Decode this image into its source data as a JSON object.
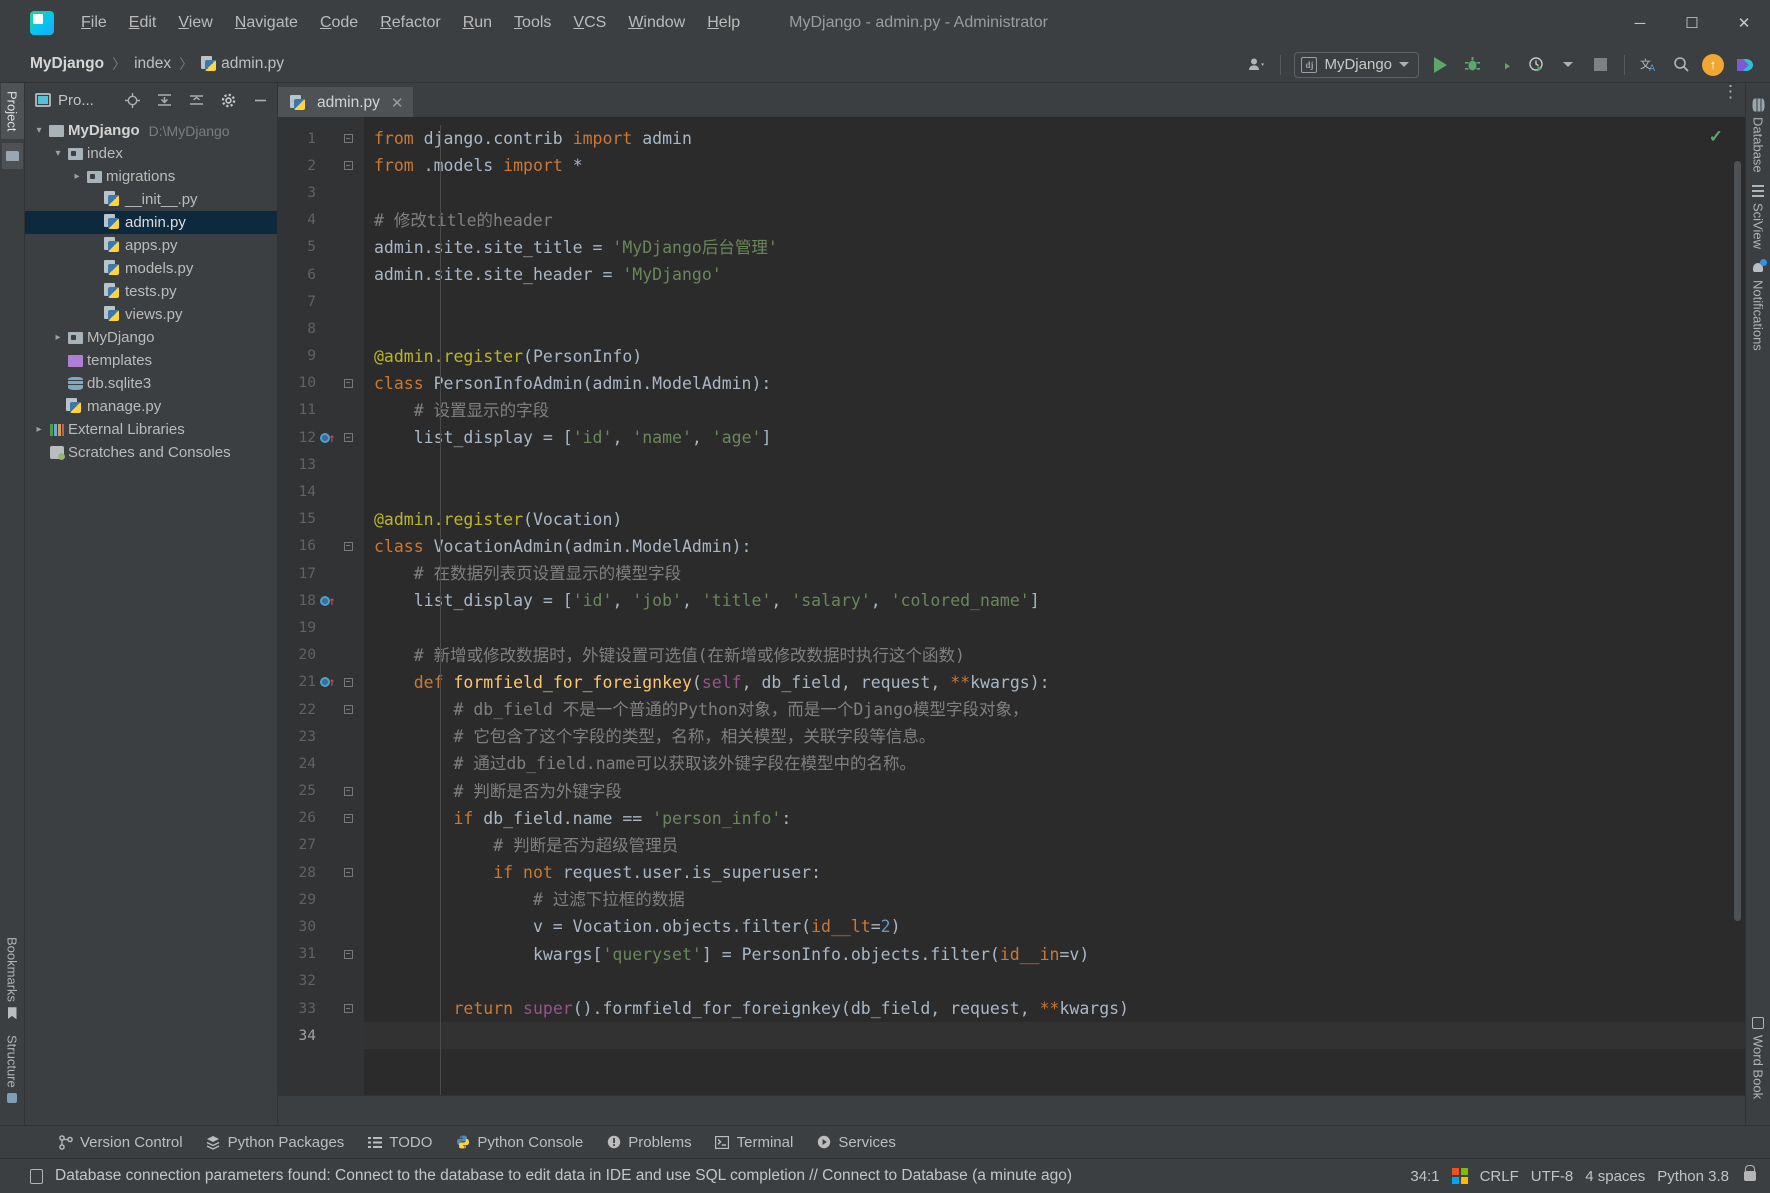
{
  "window": {
    "title": "MyDjango - admin.py - Administrator",
    "minimize": "─",
    "maximize": "☐",
    "close": "✕"
  },
  "menu": [
    {
      "label": "File"
    },
    {
      "label": "Edit"
    },
    {
      "label": "View"
    },
    {
      "label": "Navigate"
    },
    {
      "label": "Code"
    },
    {
      "label": "Refactor"
    },
    {
      "label": "Run"
    },
    {
      "label": "Tools"
    },
    {
      "label": "VCS"
    },
    {
      "label": "Window"
    },
    {
      "label": "Help"
    }
  ],
  "breadcrumb": {
    "project": "MyDjango",
    "folder": "index",
    "file": "admin.py",
    "sep": "〉"
  },
  "toolbar": {
    "run_config": "MyDjango",
    "django_badge": "dj",
    "run_label": "Run",
    "debug_label": "Debug",
    "coverage_label": "Run with Coverage",
    "profile_label": "Profile",
    "stop_label": "Stop",
    "translate_label": "文A",
    "search_label": "Search Everywhere",
    "update_label": "Update",
    "plugin_label": "Plugin"
  },
  "left_rail": [
    {
      "label": "Project",
      "icon": "project-folder-icon",
      "active": true
    },
    {
      "label": "Bookmarks",
      "icon": "bookmark-icon",
      "active": false
    },
    {
      "label": "Structure",
      "icon": "structure-icon",
      "active": false
    }
  ],
  "right_rail": [
    {
      "label": "Database",
      "icon": "database-icon"
    },
    {
      "label": "SciView",
      "icon": "grid-icon"
    },
    {
      "label": "Notifications",
      "icon": "bell-icon"
    },
    {
      "label": "Word Book",
      "icon": "wordbook-icon"
    }
  ],
  "project_panel": {
    "title": "Pro...",
    "buttons": [
      "locate-icon",
      "expand-all-icon",
      "collapse-all-icon",
      "settings-gear-icon",
      "hide-icon"
    ],
    "tree": [
      {
        "label": "MyDjango",
        "path": "D:\\MyDjango",
        "icon": "folder-icon",
        "indent": 0,
        "arrow": "down",
        "bold": true,
        "selected": false
      },
      {
        "label": "index",
        "path": "",
        "icon": "source-folder-icon",
        "indent": 1,
        "arrow": "down",
        "bold": false,
        "selected": false
      },
      {
        "label": "migrations",
        "path": "",
        "icon": "source-folder-icon",
        "indent": 2,
        "arrow": "right",
        "bold": false,
        "selected": false
      },
      {
        "label": "__init__.py",
        "path": "",
        "icon": "python-file-icon",
        "indent": 3,
        "arrow": "",
        "bold": false,
        "selected": false
      },
      {
        "label": "admin.py",
        "path": "",
        "icon": "python-file-icon",
        "indent": 3,
        "arrow": "",
        "bold": false,
        "selected": true
      },
      {
        "label": "apps.py",
        "path": "",
        "icon": "python-file-icon",
        "indent": 3,
        "arrow": "",
        "bold": false,
        "selected": false
      },
      {
        "label": "models.py",
        "path": "",
        "icon": "python-file-icon",
        "indent": 3,
        "arrow": "",
        "bold": false,
        "selected": false
      },
      {
        "label": "tests.py",
        "path": "",
        "icon": "python-file-icon",
        "indent": 3,
        "arrow": "",
        "bold": false,
        "selected": false
      },
      {
        "label": "views.py",
        "path": "",
        "icon": "python-file-icon",
        "indent": 3,
        "arrow": "",
        "bold": false,
        "selected": false
      },
      {
        "label": "MyDjango",
        "path": "",
        "icon": "source-folder-icon",
        "indent": 1,
        "arrow": "right",
        "bold": false,
        "selected": false
      },
      {
        "label": "templates",
        "path": "",
        "icon": "template-folder-icon",
        "indent": 1,
        "arrow": "",
        "bold": false,
        "selected": false
      },
      {
        "label": "db.sqlite3",
        "path": "",
        "icon": "database-file-icon",
        "indent": 1,
        "arrow": "",
        "bold": false,
        "selected": false
      },
      {
        "label": "manage.py",
        "path": "",
        "icon": "python-file-icon",
        "indent": 1,
        "arrow": "",
        "bold": false,
        "selected": false
      },
      {
        "label": "External Libraries",
        "path": "",
        "icon": "libraries-icon",
        "indent": 0,
        "arrow": "right",
        "bold": false,
        "selected": false
      },
      {
        "label": "Scratches and Consoles",
        "path": "",
        "icon": "scratches-icon",
        "indent": 0,
        "arrow": "",
        "bold": false,
        "selected": false
      }
    ]
  },
  "editor": {
    "tab": "admin.py",
    "tab_close": "✕",
    "inspection_status": "✓",
    "cursor_line": 34,
    "lines": [
      {
        "n": 1,
        "fold": "fold-end-down",
        "bp": false
      },
      {
        "n": 2,
        "fold": "fold-end-up",
        "bp": false
      },
      {
        "n": 3,
        "fold": "",
        "bp": false
      },
      {
        "n": 4,
        "fold": "",
        "bp": false
      },
      {
        "n": 5,
        "fold": "",
        "bp": false
      },
      {
        "n": 6,
        "fold": "",
        "bp": false
      },
      {
        "n": 7,
        "fold": "",
        "bp": false
      },
      {
        "n": 8,
        "fold": "",
        "bp": false
      },
      {
        "n": 9,
        "fold": "",
        "bp": false
      },
      {
        "n": 10,
        "fold": "fold-down",
        "bp": false
      },
      {
        "n": 11,
        "fold": "",
        "bp": false
      },
      {
        "n": 12,
        "fold": "fold-up",
        "bp": true
      },
      {
        "n": 13,
        "fold": "",
        "bp": false
      },
      {
        "n": 14,
        "fold": "",
        "bp": false
      },
      {
        "n": 15,
        "fold": "",
        "bp": false
      },
      {
        "n": 16,
        "fold": "fold-down",
        "bp": false
      },
      {
        "n": 17,
        "fold": "",
        "bp": false
      },
      {
        "n": 18,
        "fold": "",
        "bp": true
      },
      {
        "n": 19,
        "fold": "",
        "bp": false
      },
      {
        "n": 20,
        "fold": "",
        "bp": false
      },
      {
        "n": 21,
        "fold": "fold-down",
        "bp": true
      },
      {
        "n": 22,
        "fold": "fold-down",
        "bp": false
      },
      {
        "n": 23,
        "fold": "",
        "bp": false
      },
      {
        "n": 24,
        "fold": "",
        "bp": false
      },
      {
        "n": 25,
        "fold": "fold-up",
        "bp": false
      },
      {
        "n": 26,
        "fold": "fold-down",
        "bp": false
      },
      {
        "n": 27,
        "fold": "",
        "bp": false
      },
      {
        "n": 28,
        "fold": "fold-down",
        "bp": false
      },
      {
        "n": 29,
        "fold": "",
        "bp": false
      },
      {
        "n": 30,
        "fold": "",
        "bp": false
      },
      {
        "n": 31,
        "fold": "fold-up",
        "bp": false
      },
      {
        "n": 32,
        "fold": "",
        "bp": false
      },
      {
        "n": 33,
        "fold": "fold-up",
        "bp": false
      },
      {
        "n": 34,
        "fold": "",
        "bp": false
      }
    ],
    "source": [
      [
        {
          "t": "from ",
          "c": "kw"
        },
        {
          "t": "django.contrib ",
          "c": "plain"
        },
        {
          "t": "import ",
          "c": "kw"
        },
        {
          "t": "admin",
          "c": "plain"
        }
      ],
      [
        {
          "t": "from ",
          "c": "kw"
        },
        {
          "t": ".models ",
          "c": "plain"
        },
        {
          "t": "import ",
          "c": "kw"
        },
        {
          "t": "*",
          "c": "plain"
        }
      ],
      [],
      [
        {
          "t": "# 修改title的header",
          "c": "com"
        }
      ],
      [
        {
          "t": "admin.site.site_title = ",
          "c": "plain"
        },
        {
          "t": "'MyDjango后台管理'",
          "c": "str"
        }
      ],
      [
        {
          "t": "admin.site.site_header = ",
          "c": "plain"
        },
        {
          "t": "'MyDjango'",
          "c": "str"
        }
      ],
      [],
      [],
      [
        {
          "t": "@admin.register",
          "c": "dec"
        },
        {
          "t": "(PersonInfo)",
          "c": "plain"
        }
      ],
      [
        {
          "t": "class ",
          "c": "kw"
        },
        {
          "t": "PersonInfoAdmin(admin.ModelAdmin):",
          "c": "plain"
        }
      ],
      [
        {
          "t": "    # 设置显示的字段",
          "c": "com"
        }
      ],
      [
        {
          "t": "    list_display = [",
          "c": "plain"
        },
        {
          "t": "'id'",
          "c": "str"
        },
        {
          "t": ", ",
          "c": "plain"
        },
        {
          "t": "'name'",
          "c": "str"
        },
        {
          "t": ", ",
          "c": "plain"
        },
        {
          "t": "'age'",
          "c": "str"
        },
        {
          "t": "]",
          "c": "plain"
        }
      ],
      [],
      [],
      [
        {
          "t": "@admin.register",
          "c": "dec"
        },
        {
          "t": "(Vocation)",
          "c": "plain"
        }
      ],
      [
        {
          "t": "class ",
          "c": "kw"
        },
        {
          "t": "VocationAdmin(admin.ModelAdmin):",
          "c": "plain"
        }
      ],
      [
        {
          "t": "    # 在数据列表页设置显示的模型字段",
          "c": "com"
        }
      ],
      [
        {
          "t": "    list_display = [",
          "c": "plain"
        },
        {
          "t": "'id'",
          "c": "str"
        },
        {
          "t": ", ",
          "c": "plain"
        },
        {
          "t": "'job'",
          "c": "str"
        },
        {
          "t": ", ",
          "c": "plain"
        },
        {
          "t": "'title'",
          "c": "str"
        },
        {
          "t": ", ",
          "c": "plain"
        },
        {
          "t": "'salary'",
          "c": "str"
        },
        {
          "t": ", ",
          "c": "plain"
        },
        {
          "t": "'colored_name'",
          "c": "str"
        },
        {
          "t": "]",
          "c": "plain"
        }
      ],
      [],
      [
        {
          "t": "    # 新增或修改数据时，外键设置可选值(在新增或修改数据时执行这个函数)",
          "c": "com"
        }
      ],
      [
        {
          "t": "    def ",
          "c": "kw"
        },
        {
          "t": "formfield_for_foreignkey",
          "c": "fn"
        },
        {
          "t": "(",
          "c": "plain"
        },
        {
          "t": "self",
          "c": "self"
        },
        {
          "t": ", db_field, request, ",
          "c": "plain"
        },
        {
          "t": "**",
          "c": "kw"
        },
        {
          "t": "kwargs):",
          "c": "plain"
        }
      ],
      [
        {
          "t": "        # db_field 不是一个普通的Python对象，而是一个Django模型字段对象，",
          "c": "com"
        }
      ],
      [
        {
          "t": "        # 它包含了这个字段的类型，名称，相关模型，关联字段等信息。",
          "c": "com"
        }
      ],
      [
        {
          "t": "        # 通过db_field.name可以获取该外键字段在模型中的名称。",
          "c": "com"
        }
      ],
      [
        {
          "t": "        # 判断是否为外键字段",
          "c": "com"
        }
      ],
      [
        {
          "t": "        if ",
          "c": "kw"
        },
        {
          "t": "db_field.name == ",
          "c": "plain"
        },
        {
          "t": "'person_info'",
          "c": "str"
        },
        {
          "t": ":",
          "c": "plain"
        }
      ],
      [
        {
          "t": "            # 判断是否为超级管理员",
          "c": "com"
        }
      ],
      [
        {
          "t": "            if not ",
          "c": "kw"
        },
        {
          "t": "request.user.is_superuser:",
          "c": "plain"
        }
      ],
      [
        {
          "t": "                # 过滤下拉框的数据",
          "c": "com"
        }
      ],
      [
        {
          "t": "                v = Vocation.objects.filter(",
          "c": "plain"
        },
        {
          "t": "id__lt",
          "c": "kw"
        },
        {
          "t": "=",
          "c": "plain"
        },
        {
          "t": "2",
          "c": "num"
        },
        {
          "t": ")",
          "c": "plain"
        }
      ],
      [
        {
          "t": "                kwargs[",
          "c": "plain"
        },
        {
          "t": "'queryset'",
          "c": "str"
        },
        {
          "t": "] = PersonInfo.objects.filter(",
          "c": "plain"
        },
        {
          "t": "id__in",
          "c": "kw"
        },
        {
          "t": "=v)",
          "c": "plain"
        }
      ],
      [],
      [
        {
          "t": "        return ",
          "c": "kw"
        },
        {
          "t": "super",
          "c": "self"
        },
        {
          "t": "().formfield_for_foreignkey(db_field, request, ",
          "c": "plain"
        },
        {
          "t": "**",
          "c": "kw"
        },
        {
          "t": "kwargs)",
          "c": "plain"
        }
      ],
      []
    ]
  },
  "tool_windows": [
    {
      "label": "Version Control",
      "icon": "branch-icon"
    },
    {
      "label": "Python Packages",
      "icon": "packages-icon"
    },
    {
      "label": "TODO",
      "icon": "todo-list-icon"
    },
    {
      "label": "Python Console",
      "icon": "python-icon"
    },
    {
      "label": "Problems",
      "icon": "problems-icon"
    },
    {
      "label": "Terminal",
      "icon": "terminal-icon"
    },
    {
      "label": "Services",
      "icon": "services-icon"
    }
  ],
  "status_bar": {
    "message": "Database connection parameters found: Connect to the database to edit data in IDE and use SQL completion // Connect to Database (a minute ago)",
    "position": "34:1",
    "line_separator": "CRLF",
    "encoding": "UTF-8",
    "indent": "4 spaces",
    "interpreter": "Python 3.8",
    "os_icon": "windows-logo-icon",
    "lock_icon": "unlocked-icon"
  },
  "colors": {
    "accent_green": "#59a869",
    "selection_blue": "#0d293e",
    "panel_bg": "#3c3f41",
    "editor_bg": "#2b2b2b",
    "gutter_bg": "#313335"
  }
}
